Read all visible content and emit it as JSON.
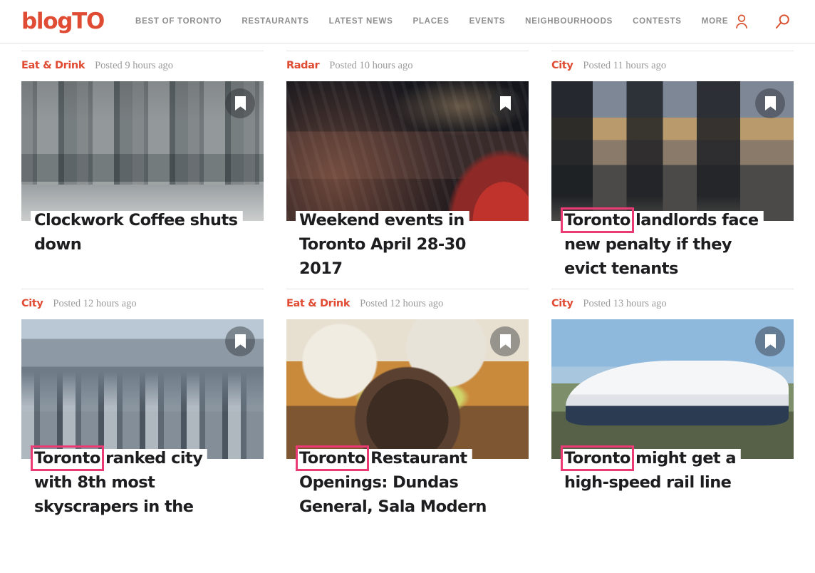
{
  "header": {
    "logo": "blogTO",
    "nav": [
      {
        "label": "BEST OF TORONTO"
      },
      {
        "label": "RESTAURANTS"
      },
      {
        "label": "LATEST NEWS"
      },
      {
        "label": "PLACES"
      },
      {
        "label": "EVENTS"
      },
      {
        "label": "NEIGHBOURHOODS"
      },
      {
        "label": "CONTESTS"
      },
      {
        "label": "MORE"
      }
    ],
    "account_icon": "user-icon",
    "search_icon": "search-icon"
  },
  "colors": {
    "brand_red": "#e04b33",
    "highlight_pink": "#ec3a74",
    "headline_text": "#1d1d1f",
    "nav_text": "#8d8d8d",
    "timestamp_text": "#9b9b9b"
  },
  "cards": [
    {
      "category": "Eat & Drink",
      "timestamp": "Posted 9 hours ago",
      "bookmark_icon": "bookmark-icon",
      "headline_lines": [
        "Clockwork Coffee shuts",
        "down"
      ],
      "highlight_term": null
    },
    {
      "category": "Radar",
      "timestamp": "Posted 10 hours ago",
      "bookmark_icon": "bookmark-icon",
      "headline_lines": [
        "Weekend events in",
        "Toronto April 28-30",
        "2017"
      ],
      "highlight_term": null
    },
    {
      "category": "City",
      "timestamp": "Posted 11 hours ago",
      "bookmark_icon": "bookmark-icon",
      "headline_lines": [
        "Toronto landlords face",
        "new penalty if they",
        "evict tenants"
      ],
      "highlight_term": "Toronto"
    },
    {
      "category": "City",
      "timestamp": "Posted 12 hours ago",
      "bookmark_icon": "bookmark-icon",
      "headline_lines": [
        "Toronto ranked city",
        "with 8th most",
        "skyscrapers in the"
      ],
      "highlight_term": "Toronto"
    },
    {
      "category": "Eat & Drink",
      "timestamp": "Posted 12 hours ago",
      "bookmark_icon": "bookmark-icon",
      "headline_lines": [
        "Toronto Restaurant",
        "Openings: Dundas",
        "General, Sala Modern"
      ],
      "highlight_term": "Toronto"
    },
    {
      "category": "City",
      "timestamp": "Posted 13 hours ago",
      "bookmark_icon": "bookmark-icon",
      "headline_lines": [
        "Toronto might get a",
        "high-speed rail line"
      ],
      "highlight_term": "Toronto"
    }
  ]
}
